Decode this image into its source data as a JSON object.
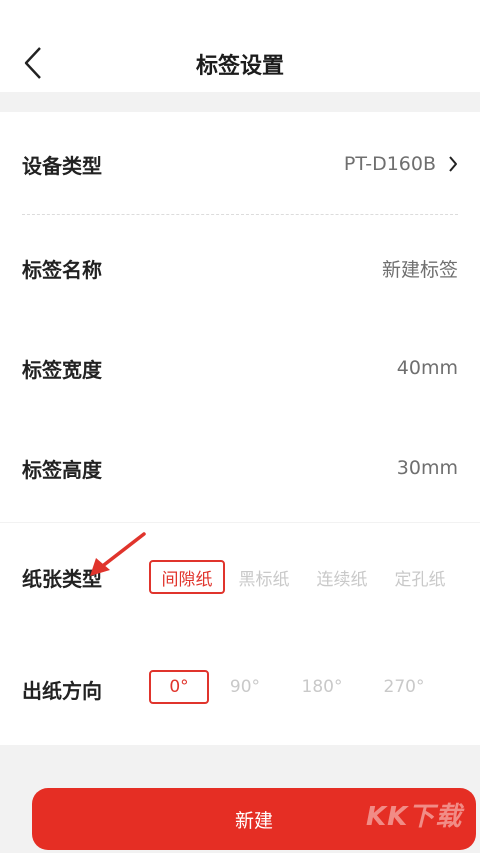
{
  "header": {
    "title": "标签设置",
    "back_icon": "chevron-left-icon"
  },
  "settings": {
    "device_type": {
      "label": "设备类型",
      "value": "PT-D160B"
    },
    "label_name": {
      "label": "标签名称",
      "value": "新建标签"
    },
    "label_width": {
      "label": "标签宽度",
      "value": "40mm"
    },
    "label_height": {
      "label": "标签高度",
      "value": "30mm"
    }
  },
  "paper_type": {
    "label": "纸张类型",
    "options": [
      "间隙纸",
      "黑标纸",
      "连续纸",
      "定孔纸"
    ],
    "selected": "间隙纸"
  },
  "direction": {
    "label": "出纸方向",
    "options": [
      "0°",
      "90°",
      "180°",
      "270°"
    ],
    "selected": "0°"
  },
  "actions": {
    "create_label": "新建"
  },
  "watermark": "KK下载",
  "colors": {
    "accent": "#e52e24",
    "background": "#f2f2f2"
  }
}
